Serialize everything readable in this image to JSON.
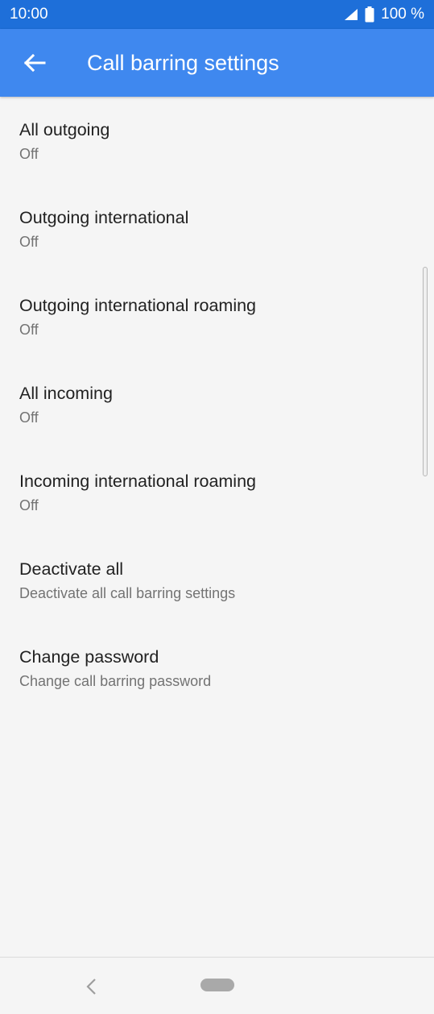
{
  "status_bar": {
    "time": "10:00",
    "battery_text": "100 %",
    "icons": [
      "signal-icon",
      "battery-icon"
    ]
  },
  "app_bar": {
    "title": "Call barring settings",
    "back_icon": "back-arrow-icon"
  },
  "settings": [
    {
      "title": "All outgoing",
      "subtitle": "Off"
    },
    {
      "title": "Outgoing international",
      "subtitle": "Off"
    },
    {
      "title": "Outgoing international roaming",
      "subtitle": "Off"
    },
    {
      "title": "All incoming",
      "subtitle": "Off"
    },
    {
      "title": "Incoming international roaming",
      "subtitle": "Off"
    },
    {
      "title": "Deactivate all",
      "subtitle": "Deactivate all call barring settings"
    },
    {
      "title": "Change password",
      "subtitle": "Change call barring password"
    }
  ],
  "nav_bar": {
    "icons": [
      "nav-back-icon",
      "home-pill-icon"
    ]
  },
  "colors": {
    "status_bar": "#1e6fd9",
    "app_bar": "#3f88ef",
    "background": "#f5f5f5",
    "title_text": "#212121",
    "subtitle_text": "#737373"
  }
}
